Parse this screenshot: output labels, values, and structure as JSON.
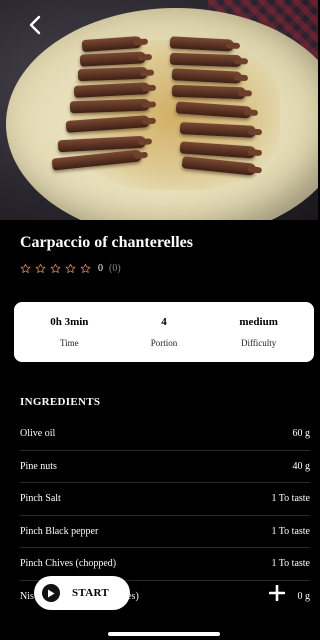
{
  "recipe": {
    "title": "Carpaccio of chanterelles",
    "rating": {
      "stars": 5,
      "filled": 0,
      "score": "0",
      "count": "(0)",
      "star_color": "#c8895a"
    }
  },
  "info": [
    {
      "value": "0h 3min",
      "label": "Time"
    },
    {
      "value": "4",
      "label": "Portion"
    },
    {
      "value": "medium",
      "label": "Difficulty"
    }
  ],
  "ingredients": {
    "heading": "INGREDIENTS",
    "items": [
      {
        "name": "Olive oil",
        "amount": "60 g"
      },
      {
        "name": "Pine nuts",
        "amount": "40 g"
      },
      {
        "name": "Pinch Salt",
        "amount": "1 To taste"
      },
      {
        "name": "Pinch Black pepper",
        "amount": "1 To taste"
      },
      {
        "name": "Pinch Chives (chopped)",
        "amount": "1 To taste"
      },
      {
        "name": "Nis",
        "tail": "ates)",
        "amount": "0 g"
      }
    ]
  },
  "controls": {
    "back_icon": "chevron-left-icon",
    "start_label": "START",
    "start_icon": "play-icon",
    "add_icon": "plus-icon"
  }
}
